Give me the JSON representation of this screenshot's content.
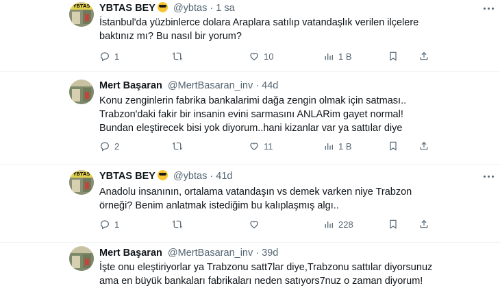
{
  "tweets": [
    {
      "name": "YBTAS BEY",
      "has_emoji": true,
      "handle": "@ybtas",
      "dot": "·",
      "time": "1 sa",
      "avatar_text": "YBTAS",
      "lines": [
        "İstanbul'da yüzbinlerce dolara Araplara satılıp vatandaşlık verilen ilçelere",
        "baktınız mı? Bu nasıl bir yorum?"
      ],
      "replies": "1",
      "retweets": "",
      "likes": "10",
      "views": "1 B"
    },
    {
      "name": "Mert Başaran",
      "has_emoji": false,
      "handle": "@MertBasaran_inv",
      "dot": "·",
      "time": "44d",
      "avatar_text": "",
      "lines": [
        "Konu zenginlerin fabrika bankalarimi dağa zengin olmak için satması..",
        "Trabzon'daki fakir bir insanin evini sarmasını ANLARim gayet normal!",
        "Bundan eleştirecek bisi yok diyorum..hani kizanlar var ya sattılar diye"
      ],
      "replies": "2",
      "retweets": "",
      "likes": "11",
      "views": "1 B"
    },
    {
      "name": "YBTAS BEY",
      "has_emoji": true,
      "handle": "@ybtas",
      "dot": "·",
      "time": "41d",
      "avatar_text": "YBTAS",
      "lines": [
        "Anadolu insanının, ortalama vatandaşın vs demek varken niye Trabzon",
        "örneği? Benim anlatmak istediğim bu kalıplaşmış algı.."
      ],
      "replies": "1",
      "retweets": "",
      "likes": "",
      "views": "228"
    },
    {
      "name": "Mert Başaran",
      "has_emoji": false,
      "handle": "@MertBasaran_inv",
      "dot": "·",
      "time": "39d",
      "avatar_text": "",
      "lines": [
        "İşte onu eleştiriyorlar ya Trabzonu satt7lar diye,Trabzonu sattılar diyorsunuz",
        "ama en büyük bankaları fabrikaları neden satıyors7nuz o zaman diyorum!"
      ]
    }
  ],
  "colors": {
    "text": "#0f1419",
    "muted": "#536471",
    "border": "#eff3f4",
    "emoji": "#f7c531"
  },
  "icons": [
    "reply-icon",
    "retweet-icon",
    "like-icon",
    "views-icon",
    "bookmark-icon",
    "share-icon",
    "more-icon"
  ]
}
